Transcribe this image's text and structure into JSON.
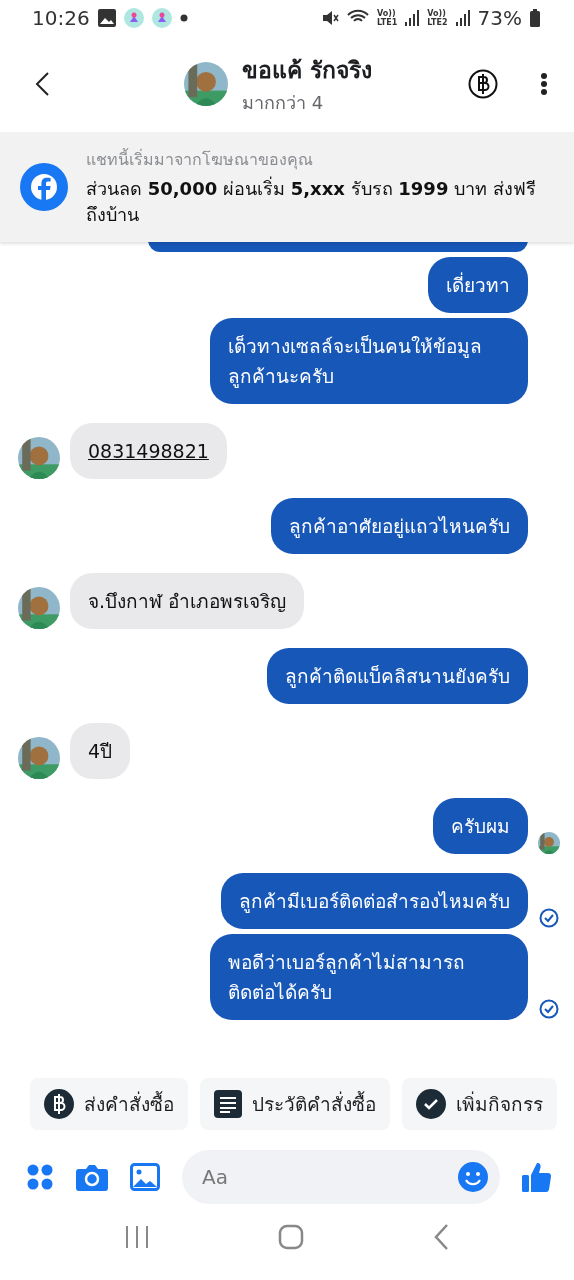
{
  "status_bar": {
    "time": "10:26",
    "sims": [
      {
        "top": "Vo))",
        "bottom": "LTE1"
      },
      {
        "top": "Vo))",
        "bottom": "LTE2"
      }
    ],
    "battery": "73%"
  },
  "header": {
    "name": "ขอแค้ รักจริง",
    "subtitle": "มากกว่า 4"
  },
  "ad_banner": {
    "caption": "แชทนี้เริ่มมาจากโฆษณาของคุณ",
    "text": "ส่วนลด **50,000** ผ่อนเริ่ม **5,xxx** รับรถ **1999** บาท ส่งฟรีถึงบ้าน"
  },
  "messages": [
    {
      "kind": "sent",
      "seen": false,
      "delivered": false
    },
    {
      "kind": "sent",
      "text": "เดี่ยวทา",
      "seen": false,
      "delivered": false
    },
    {
      "kind": "sent",
      "text": "เด็วทางเซลล์จะเป็นคนให้ข้อมูลลูกค้านะครับ",
      "seen": false,
      "delivered": false
    },
    {
      "kind": "received",
      "text": "0831498821",
      "link": true
    },
    {
      "kind": "sent",
      "text": "ลูกค้าอาศัยอยู่แถวไหนครับ",
      "seen": false,
      "delivered": false
    },
    {
      "kind": "received",
      "text": "จ.บึงกาฬ อำเภอพรเจริญ",
      "link": false
    },
    {
      "kind": "sent",
      "text": "ลูกค้าติดแบ็คลิสนานยังครับ",
      "seen": false,
      "delivered": false
    },
    {
      "kind": "received",
      "text": "4ปี",
      "link": false
    },
    {
      "kind": "sent",
      "text": "ครับผม",
      "seen": true,
      "delivered": false
    },
    {
      "kind": "sent",
      "text": "ลูกค้ามีเบอร์ติดต่อสำรองไหมครับ",
      "seen": false,
      "delivered": true
    },
    {
      "kind": "sent",
      "text": "พอดีว่าเบอร์ลูกค้าไม่สามารถติดต่อได้ครับ",
      "seen": false,
      "delivered": true
    }
  ],
  "quick_actions": [
    {
      "kind": "baht",
      "label": "ส่งคำสั่งซื้อ"
    },
    {
      "kind": "list",
      "label": "ประวัติคำสั่งซื้อ"
    },
    {
      "kind": "check",
      "label": "เพิ่มกิจกรร"
    }
  ],
  "composer": {
    "placeholder": "Aa"
  }
}
